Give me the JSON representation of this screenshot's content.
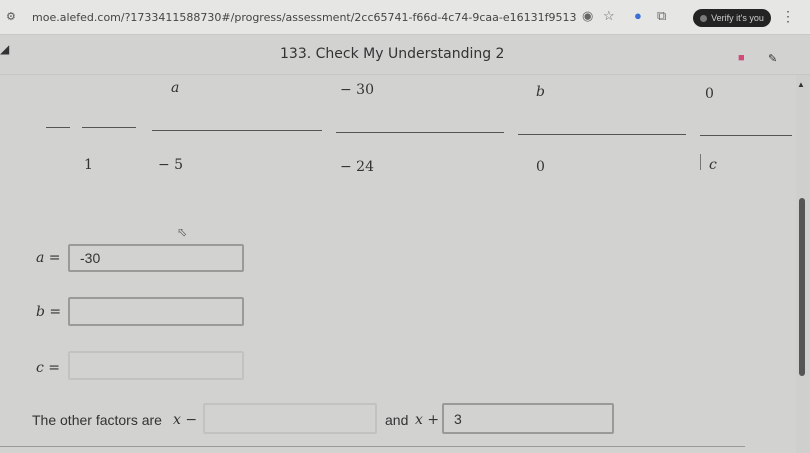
{
  "browser": {
    "url": "moe.alefed.com/?1733411588730#/progress/assessment/2cc65741-f66d-4c74-9caa-e16131f9513d/lesson/df705d83-208e-4...",
    "verify_label": "Verify it's you"
  },
  "lesson": {
    "title": "133. Check My Understanding 2"
  },
  "table": {
    "row1": [
      "a",
      "− 30",
      "b",
      "0"
    ],
    "row3": [
      "1",
      "− 5",
      "− 24",
      "0",
      "c"
    ]
  },
  "answers": {
    "a_label": "a =",
    "a_value": "-30",
    "b_label": "b =",
    "b_value": "",
    "c_label": "c =",
    "c_value": ""
  },
  "factors": {
    "prefix": "The other factors are",
    "first_expr": "x −",
    "first_value": "",
    "joiner": "and",
    "second_expr": "x +",
    "second_value": "3"
  },
  "colors": {
    "page_bg": "#d2d2d0",
    "flag": "#d04a7a"
  }
}
